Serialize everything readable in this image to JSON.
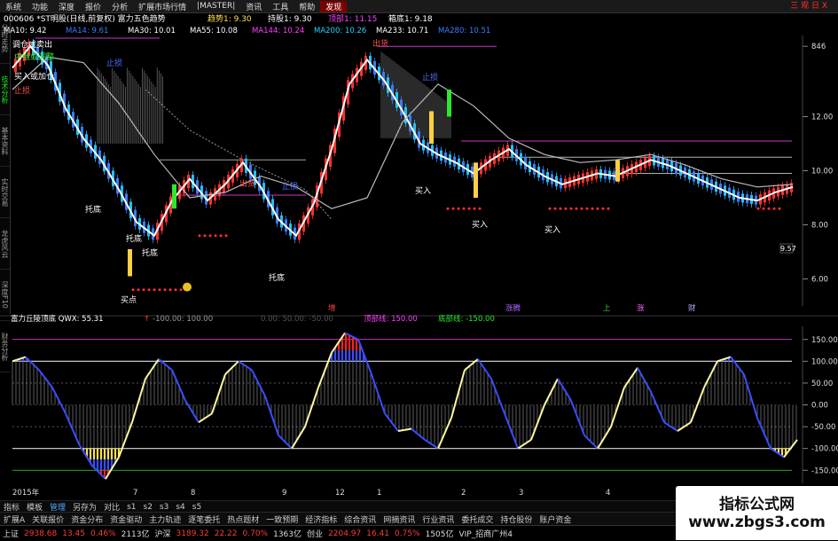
{
  "menu": {
    "items": [
      "系统",
      "功能",
      "深度",
      "报价",
      "分析",
      "扩展市场行情",
      "|MASTER|",
      "资讯",
      "工具",
      "帮助"
    ],
    "active": "发现",
    "close": "三 观 日 X"
  },
  "side_tabs": [
    "分时走势",
    "技术分析",
    "基本资料",
    "实时交易",
    "龙虎风云",
    "深度F10",
    "财务分析"
  ],
  "side_active": 1,
  "header": {
    "line1": [
      {
        "t": "000606 *ST明股(日线,前复权) 富力五色趋势",
        "c": "#ffffff"
      },
      {
        "t": "趋势1: 9.30",
        "c": "#ffe04a"
      },
      {
        "t": "持股1: 9.30",
        "c": "#ffffff"
      },
      {
        "t": "顶部1: 11.15",
        "c": "#ff40ff"
      },
      {
        "t": "箱底1: 9.18",
        "c": "#ffffff"
      }
    ],
    "line2": [
      {
        "t": "MA10: 9.42",
        "c": "#ffffff"
      },
      {
        "t": "MA14: 9.61",
        "c": "#3a7bff"
      },
      {
        "t": "MA30: 10.01",
        "c": "#ffffff"
      },
      {
        "t": "MA55: 10.08",
        "c": "#ffffff"
      },
      {
        "t": "MA144: 10.24",
        "c": "#ff40ff"
      },
      {
        "t": "MA200: 10.26",
        "c": "#26d0ff"
      },
      {
        "t": "MA233: 10.71",
        "c": "#ffffff"
      },
      {
        "t": "MA280: 10.51",
        "c": "#3a7bff"
      }
    ]
  },
  "chart_data": [
    {
      "type": "line",
      "title": "000606 *ST明股(日线,前复权) 富力五色趋势",
      "yticks": [
        "846",
        "12.00",
        "10.00",
        "8.00",
        "6.00"
      ],
      "ylim": [
        5,
        15
      ],
      "series": [
        {
          "name": "价格",
          "color": "#ffffff",
          "x": [
            0,
            20,
            40,
            60,
            80,
            100,
            120,
            140,
            160,
            180,
            200,
            220,
            240,
            260,
            280,
            300,
            320,
            340,
            360,
            380,
            400,
            420,
            440,
            460,
            480,
            500,
            520,
            540,
            560,
            580,
            600,
            620,
            640,
            660,
            680,
            700,
            720,
            740,
            760,
            780,
            800,
            820,
            840,
            860,
            880
          ],
          "values": [
            13.8,
            14.6,
            13.9,
            12.3,
            11.2,
            10.4,
            9.3,
            8.1,
            7.6,
            8.9,
            9.7,
            8.9,
            9.5,
            10.3,
            9.4,
            8.2,
            7.6,
            8.8,
            10.8,
            13.2,
            14.1,
            13.3,
            12.2,
            11.0,
            10.6,
            10.3,
            9.9,
            10.4,
            10.8,
            10.2,
            9.8,
            9.5,
            9.7,
            9.9,
            9.8,
            10.1,
            10.4,
            10.2,
            9.9,
            9.6,
            9.3,
            9.0,
            8.9,
            9.2,
            9.4
          ]
        },
        {
          "name": "MA233",
          "color": "#bbbbbb",
          "x": [
            0,
            40,
            80,
            120,
            160,
            200,
            240,
            280,
            320,
            360,
            400,
            440,
            480,
            520,
            560,
            600,
            640,
            680,
            720,
            760,
            800,
            840,
            880
          ],
          "values": [
            13.0,
            14.2,
            14.0,
            12.5,
            10.6,
            9.0,
            9.2,
            9.8,
            9.4,
            8.6,
            9.0,
            11.8,
            13.2,
            12.4,
            11.2,
            10.6,
            10.3,
            10.4,
            10.6,
            10.2,
            9.7,
            9.4,
            9.5
          ]
        }
      ],
      "annotations": [
        {
          "t": "调仓或卖出",
          "c": "#ffffff"
        },
        {
          "t": "中继或调整",
          "c": "#2ee62e"
        },
        {
          "t": "买入或加仓",
          "c": "#ffffff"
        },
        {
          "t": "止损",
          "c": "#ff5050"
        },
        {
          "t": "止损",
          "c": "#5070ff"
        },
        {
          "t": "托底",
          "c": "#ffffff"
        },
        {
          "t": "托底",
          "c": "#ffffff"
        },
        {
          "t": "托底",
          "c": "#ffffff"
        },
        {
          "t": "托底",
          "c": "#ffffff"
        },
        {
          "t": "买点",
          "c": "#ffffff"
        },
        {
          "t": "出货",
          "c": "#ff5050"
        },
        {
          "t": "止损",
          "c": "#5070ff"
        },
        {
          "t": "出货",
          "c": "#ff5050"
        },
        {
          "t": "止损",
          "c": "#5070ff"
        },
        {
          "t": "买入",
          "c": "#ffffff"
        },
        {
          "t": "买入",
          "c": "#ffffff"
        },
        {
          "t": "买入",
          "c": "#ffffff"
        }
      ],
      "price_tag": "9.57",
      "bottom_labels": [
        {
          "t": "增",
          "c": "#ff4040"
        },
        {
          "t": "涨腾",
          "c": "#b060ff"
        },
        {
          "t": "上",
          "c": "#40d040"
        },
        {
          "t": "涨",
          "c": "#ff60ff"
        },
        {
          "t": "财",
          "c": "#b0b0ff"
        }
      ]
    },
    {
      "type": "line",
      "title": "富力丘陵顶底",
      "legend": [
        {
          "t": "富力丘陵顶底 QWX: 55.31",
          "c": "#ffffff"
        },
        {
          "t": "↑",
          "c": "#ff3030"
        },
        {
          "t": "-100.00: 100.00",
          "c": "#9a9a9a"
        },
        {
          "t": "0.00: 50.00: -50.00",
          "c": "#555555"
        },
        {
          "t": "顶部线: 150.00",
          "c": "#ff40ff"
        },
        {
          "t": "底部线: -150.00",
          "c": "#2ee62e"
        }
      ],
      "yticks": [
        "150.00",
        "100.00",
        "50.00",
        "0.00",
        "-50.00",
        "-100.00",
        "-150.00"
      ],
      "ylim": [
        -180,
        180
      ],
      "series": [
        {
          "name": "QWX",
          "color": "#fff7a0",
          "x": [
            0,
            15,
            30,
            45,
            60,
            75,
            90,
            105,
            120,
            135,
            150,
            165,
            180,
            195,
            210,
            225,
            240,
            255,
            270,
            285,
            300,
            315,
            330,
            345,
            360,
            375,
            390,
            405,
            420,
            435,
            450,
            465,
            480,
            495,
            510,
            525,
            540,
            555,
            570,
            585,
            600,
            615,
            630,
            645,
            660,
            675,
            690,
            705,
            720,
            735,
            750,
            765,
            780,
            795,
            810,
            825,
            840,
            855,
            870,
            885
          ],
          "values": [
            100,
            110,
            80,
            40,
            -20,
            -90,
            -140,
            -170,
            -120,
            -40,
            60,
            105,
            80,
            10,
            -40,
            -20,
            70,
            100,
            80,
            20,
            -70,
            -100,
            -50,
            40,
            120,
            165,
            150,
            70,
            -20,
            -60,
            -55,
            -80,
            -100,
            -30,
            80,
            105,
            60,
            -20,
            -100,
            -80,
            0,
            60,
            10,
            -70,
            -100,
            -50,
            40,
            85,
            30,
            -40,
            -60,
            -40,
            40,
            100,
            110,
            70,
            -30,
            -100,
            -120,
            -80
          ]
        }
      ],
      "x_labels": [
        "2015年",
        "7",
        "8",
        "9",
        "12",
        "1",
        "2",
        "3",
        "4"
      ]
    }
  ],
  "bottom_tabs": [
    "指标",
    "模板",
    "管理",
    "另存为",
    "对比",
    "s1",
    "s2",
    "s3",
    "s4",
    "s5"
  ],
  "bottom_active": 2,
  "func_tabs": [
    "扩展A",
    "关联报价",
    "资金分布",
    "资金驱动",
    "主力轨迹",
    "逐笔委托",
    "热点题材",
    "一致预期",
    "经济指标",
    "综合资讯",
    "网摘资讯",
    "行业资讯",
    "委托成交",
    "持仓股份",
    "账户资金"
  ],
  "status": [
    {
      "t": "上证",
      "c": "#ddd"
    },
    {
      "t": "2938.68",
      "c": "#ff3b3b"
    },
    {
      "t": "13.45",
      "c": "#ff3b3b"
    },
    {
      "t": "0.46%",
      "c": "#ff3b3b"
    },
    {
      "t": "2113亿",
      "c": "#ddd"
    },
    {
      "t": "沪深",
      "c": "#ddd"
    },
    {
      "t": "3189.32",
      "c": "#ff3b3b"
    },
    {
      "t": "22.22",
      "c": "#ff3b3b"
    },
    {
      "t": "0.70%",
      "c": "#ff3b3b"
    },
    {
      "t": "1363亿",
      "c": "#ddd"
    },
    {
      "t": "创业",
      "c": "#ddd"
    },
    {
      "t": "2204.97",
      "c": "#ff3b3b"
    },
    {
      "t": "16.41",
      "c": "#ff3b3b"
    },
    {
      "t": "0.75%",
      "c": "#ff3b3b"
    },
    {
      "t": "1505亿",
      "c": "#ddd"
    },
    {
      "t": "VIP_招商广州4",
      "c": "#ddd"
    }
  ],
  "watermark": {
    "line1": "指标公式网",
    "line2": "www.zbgs3.com"
  }
}
